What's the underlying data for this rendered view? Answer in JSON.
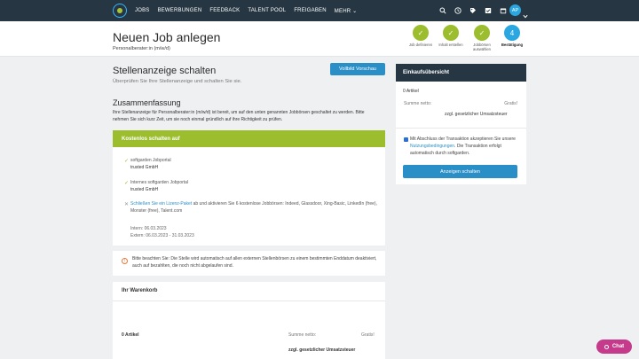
{
  "nav": {
    "links": [
      "JOBS",
      "BEWERBUNGEN",
      "FEEDBACK",
      "TALENT POOL",
      "FREIGABEN",
      "MEHR"
    ],
    "avatar_initials": "AP",
    "icons": [
      "search-icon",
      "clock-icon",
      "tag-icon",
      "inbox-icon",
      "calendar-icon"
    ]
  },
  "header": {
    "title": "Neuen Job anlegen",
    "subtitle": "Personalberater:in (m/w/d)",
    "steps": [
      {
        "label": "Job definieren",
        "state": "done",
        "symbol": "✓"
      },
      {
        "label": "Inhalt erstellen",
        "state": "done",
        "symbol": "✓"
      },
      {
        "label": "Jobbörsen auswählen",
        "state": "done",
        "symbol": "✓"
      },
      {
        "label": "Bestätigung",
        "state": "active",
        "symbol": "4"
      }
    ]
  },
  "main": {
    "title": "Stellenanzeige schalten",
    "subtitle": "Überprüfen Sie Ihre Stellenanzeige und schalten Sie sie.",
    "preview_button": "Vollbild Vorschau",
    "summary_title": "Zusammenfassung",
    "summary_text": "Ihre Stellenanzeige für Personalberater:in (m/w/d) ist bereit, um auf den unten genannten Jobbörsen geschaltet zu werden. Bitte nehmen Sie sich kurz Zeit, um sie noch einmal gründlich auf ihre Richtigkeit zu prüfen."
  },
  "free": {
    "header": "Kostenlos schalten auf",
    "item1": {
      "name": "softgarden Jobportal",
      "company": "trusted GmbH"
    },
    "item2": {
      "name": "Internes softgarden Jobportal",
      "company": "trusted GmbH"
    },
    "item3": {
      "link": "Schließen Sie ein Lizenz-Paket",
      "text": " ab und aktivieren Sie 6 kostenlose Jobbörsen: Indeed, Glassdoor, Xing-Basic, LinkedIn (free), Monster (free), Talent.com"
    },
    "intern": "Intern: 06.03.2023",
    "extern": "Extern: 06.03.2023 - 31.03.2023"
  },
  "notice": "Bitte beachten Sie: Die Stelle wird automatisch auf allen externen Stellenbörsen zu einem bestimmten Enddatum deaktiviert, auch auf bezahlten, die noch nicht abgelaufen sind.",
  "cart": {
    "title": "Ihr Warenkorb",
    "count": "0 Artikel",
    "netto_label": "Summe netto:",
    "netto_value": "Gratis!",
    "tax": "zzgl. gesetzlicher Umsatzsteuer"
  },
  "side": {
    "title": "Einkaufsübersicht",
    "count": "0 Artikel",
    "netto_label": "Summe netto:",
    "netto_value": "Gratis!",
    "tax": "zzgl. gesetzlicher Umsatzsteuer",
    "terms_pre": "Mit Abschluss der Transaktion akzeptieren Sie unsere ",
    "terms_link": "Nutzungsbedingungen",
    "terms_post": ". Die Transaktion erfolgt automatisch durch softgarden.",
    "button": "Anzeigen schalten"
  },
  "chat": "Chat",
  "colors": {
    "navy": "#263743",
    "accent": "#2a8fc7",
    "green": "#9bbd2e",
    "chat": "#c63a8c"
  }
}
